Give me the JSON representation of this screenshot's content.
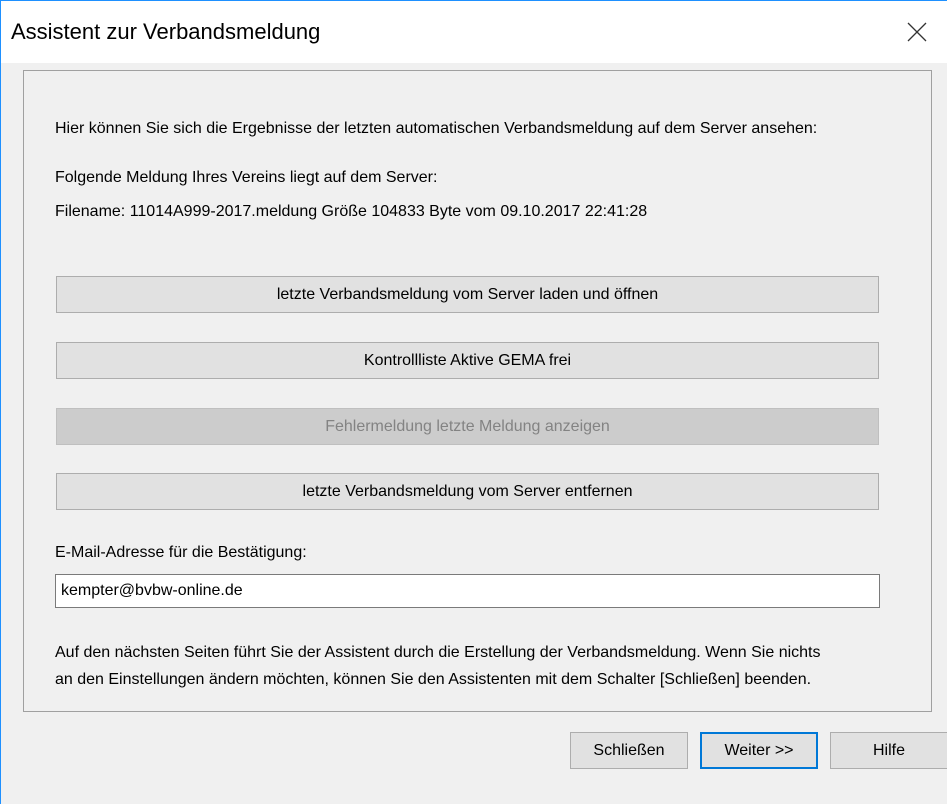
{
  "window": {
    "title": "Assistent zur Verbandsmeldung",
    "close_icon": "close-icon"
  },
  "panel": {
    "intro": "Hier können Sie sich die Ergebnisse der letzten automatischen Verbandsmeldung auf dem Server ansehen:",
    "server_notice": "Folgende Meldung Ihres Vereins liegt auf dem Server:",
    "file_info": "Filename: 11014A999-2017.meldung Größe 104833 Byte vom 09.10.2017 22:41:28",
    "buttons": [
      {
        "label": "letzte Verbandsmeldung vom Server laden und öffnen",
        "enabled": true
      },
      {
        "label": "Kontrollliste Aktive GEMA frei",
        "enabled": true
      },
      {
        "label": "Fehlermeldung letzte Meldung anzeigen",
        "enabled": false
      },
      {
        "label": "letzte Verbandsmeldung vom Server entfernen",
        "enabled": true
      }
    ],
    "email_label": "E-Mail-Adresse für die Bestätigung:",
    "email_value": "kempter@bvbw-online.de",
    "hint_line1": "Auf den nächsten Seiten führt Sie der Assistent durch die Erstellung der Verbandsmeldung. Wenn Sie nichts",
    "hint_line2": "an den Einstellungen ändern möchten, können Sie den Assistenten mit dem Schalter [Schließen] beenden."
  },
  "footer": {
    "close_label": "Schließen",
    "next_label": "Weiter >>",
    "help_label": "Hilfe"
  },
  "colors": {
    "window_border": "#1e90ff",
    "default_button_border": "#0078d7",
    "disabled_text": "#838383"
  }
}
